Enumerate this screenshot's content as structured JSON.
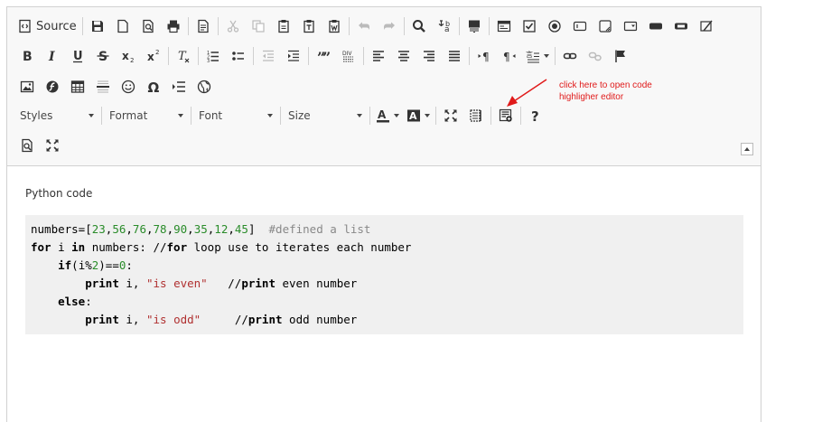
{
  "toolbar": {
    "source_label": "Source",
    "styles_label": "Styles",
    "format_label": "Format",
    "font_label": "Font",
    "size_label": "Size"
  },
  "annotation": {
    "line1": "click here to open code",
    "line2": "highligher editor",
    "color": "#e01a1a"
  },
  "content": {
    "paragraph": "Python code",
    "code": {
      "l1_a": "numbers=[",
      "l1_nums": [
        "23",
        "56",
        "76",
        "78",
        "90",
        "35",
        "12",
        "45"
      ],
      "l1_b": "]  ",
      "l1_comment": "#defined a list",
      "l2_for": "for",
      "l2_a": " i ",
      "l2_in": "in",
      "l2_b": " numbers: //",
      "l2_for2": "for",
      "l2_c": " loop use to iterates each number",
      "l3_indent": "    ",
      "l3_if": "if",
      "l3_a": "(i%",
      "l3_n1": "2",
      "l3_b": ")==",
      "l3_n2": "0",
      "l3_c": ":",
      "l4_indent": "        ",
      "l4_print": "print",
      "l4_a": " i, ",
      "l4_str": "\"is even\"",
      "l4_b": "   //",
      "l4_print2": "print",
      "l4_c": " even number",
      "l5_indent": "    ",
      "l5_else": "else",
      "l5_a": ":",
      "l6_indent": "        ",
      "l6_print": "print",
      "l6_a": " i, ",
      "l6_str": "\"is odd\"",
      "l6_b": "     //",
      "l6_print2": "print",
      "l6_c": " odd number"
    }
  }
}
